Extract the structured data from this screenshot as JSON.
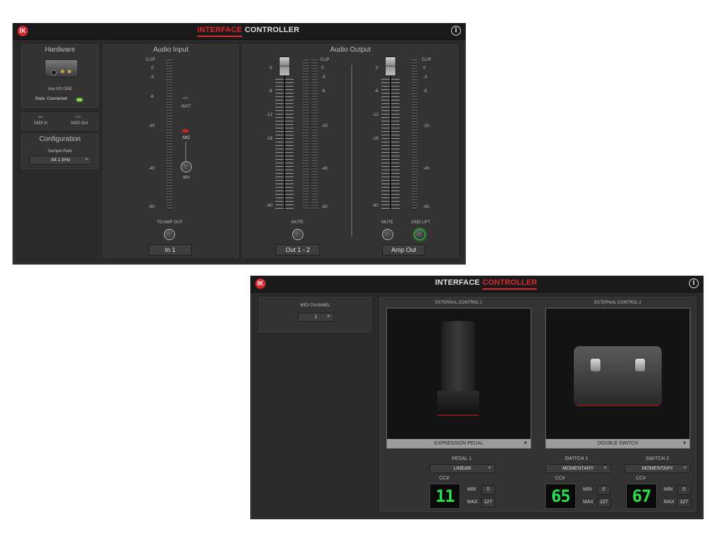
{
  "interface_window": {
    "tabs": [
      {
        "label": "INTERFACE",
        "active": true
      },
      {
        "label": "CONTROLLER",
        "active": false
      }
    ],
    "logo": "IK",
    "hardware": {
      "title": "Hardware",
      "device_name": "Axe I/O ONE",
      "state": "State: Connected",
      "midi_in": "MIDI In",
      "midi_out": "MIDI Out"
    },
    "configuration": {
      "title": "Configuration",
      "sample_rate_label": "Sample Rate",
      "sample_rate_value": "44.1 kHz"
    },
    "audio_input": {
      "title": "Audio Input",
      "scale": [
        "CLIP",
        "0",
        "-3",
        "-6",
        "-20",
        "-40",
        "-60"
      ],
      "inst": "INST",
      "mic": "MIC",
      "v48": "48V",
      "to_amp_out": "TO AMP OUT",
      "channel": "In 1"
    },
    "audio_output": {
      "title": "Audio Output",
      "fader_scale": [
        "0",
        "-6",
        "-12",
        "-18",
        "-60"
      ],
      "meter_scale": [
        "CLIP",
        "0",
        "-3",
        "-6",
        "-20",
        "-40",
        "-60"
      ],
      "mute": "MUTE",
      "gnd_lift": "GND LIFT",
      "channel_1": "Out 1 - 2",
      "channel_2": "Amp Out"
    }
  },
  "controller_window": {
    "tabs": [
      {
        "label": "INTERFACE",
        "active": false
      },
      {
        "label": "CONTROLLER",
        "active": true
      }
    ],
    "logo": "IK",
    "midi_channel": {
      "label": "MIDI CHANNEL",
      "value": "1"
    },
    "external_1": {
      "title": "EXTERNAL CONTROL 1",
      "device": "EXPRESSION PEDAL",
      "pedal_label": "PEDAL 1",
      "curve": "LINEAR",
      "cc_label": "CC#",
      "cc_value": "11",
      "min_label": "MIN",
      "min_value": "0",
      "max_label": "MAX",
      "max_value": "127"
    },
    "external_2": {
      "title": "EXTERNAL CONTROL 2",
      "device": "DOUBLE SWITCH",
      "switch1": {
        "label": "SWITCH 1",
        "mode": "MOMENTARY",
        "cc_label": "CC#",
        "cc_value": "65",
        "min_label": "MIN",
        "min_value": "0",
        "max_label": "MAX",
        "max_value": "127"
      },
      "switch2": {
        "label": "SWITCH 2",
        "mode": "MOMENTARY",
        "cc_label": "CC#",
        "cc_value": "67",
        "min_label": "MIN",
        "min_value": "0",
        "max_label": "MAX",
        "max_value": "127"
      }
    }
  },
  "colors": {
    "accent_red": "#e2262b",
    "lcd_green": "#29e04a",
    "gnd_green": "#2ecc40",
    "led_green": "#8be04a"
  },
  "icons": [
    "info-icon",
    "ik-logo",
    "expression-pedal-image",
    "double-switch-image",
    "audio-interface-image"
  ]
}
